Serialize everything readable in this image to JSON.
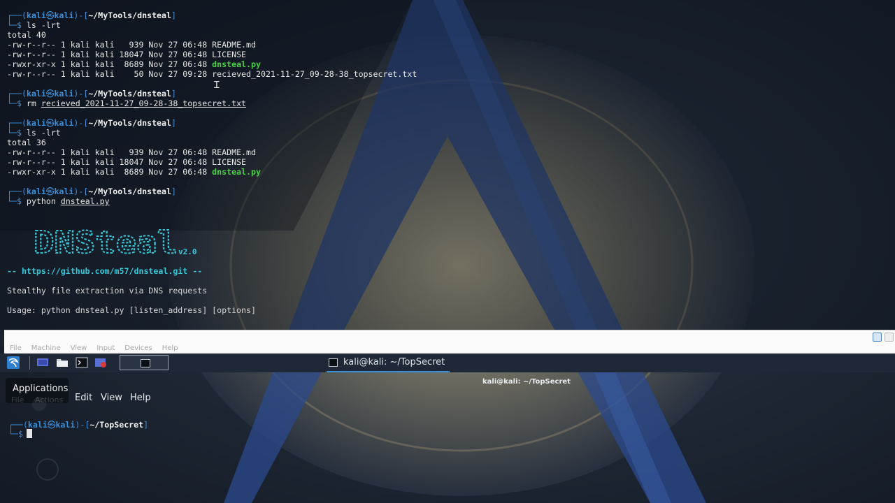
{
  "terminal_top": {
    "prompt_user": "kali",
    "prompt_at": "㉿",
    "prompt_host": "kali",
    "prompt_path": "~/MyTools/dnsteal",
    "commands": {
      "c1": "ls -lrt",
      "c2_cmd": "rm",
      "c2_arg": "recieved_2021-11-27_09-28-38_topsecret.txt",
      "c3": "ls -lrt",
      "c4_cmd": "python",
      "c4_arg": "dnsteal.py"
    },
    "listing1": {
      "total": "total 40",
      "rows": [
        {
          "meta": "-rw-r--r-- 1 kali kali   939 Nov 27 06:48 ",
          "name": "README.md"
        },
        {
          "meta": "-rw-r--r-- 1 kali kali 18047 Nov 27 06:48 ",
          "name": "LICENSE"
        },
        {
          "meta": "-rwxr-xr-x 1 kali kali  8689 Nov 27 06:48 ",
          "name": "dnsteal.py"
        },
        {
          "meta": "-rw-r--r-- 1 kali kali    50 Nov 27 09:28 ",
          "name": "recieved_2021-11-27_09-28-38_topsecret.txt"
        }
      ]
    },
    "listing2": {
      "total": "total 36",
      "rows": [
        {
          "meta": "-rw-r--r-- 1 kali kali   939 Nov 27 06:48 ",
          "name": "README.md"
        },
        {
          "meta": "-rw-r--r-- 1 kali kali 18047 Nov 27 06:48 ",
          "name": "LICENSE"
        },
        {
          "meta": "-rwxr-xr-x 1 kali kali  8689 Nov 27 06:48 ",
          "name": "dnsteal.py"
        }
      ]
    },
    "banner": {
      "logo_text": "DNSteal",
      "version": "v2.0",
      "url_line": "-- https://github.com/m57/dnsteal.git --",
      "tagline": "Stealthy file extraction via DNS requests",
      "usage": "Usage: python dnsteal.py [listen_address] [options]"
    }
  },
  "vm_menubar": {
    "items": [
      "File",
      "Machine",
      "View",
      "Input",
      "Devices",
      "Help"
    ]
  },
  "taskbar": {
    "task_label": "kali@kali: ~/TopSecret"
  },
  "window": {
    "title": "kali@kali: ~/TopSecret",
    "tooltip": "Applications",
    "menu": {
      "file": "File",
      "actions": "Actions",
      "edit": "Edit",
      "view": "View",
      "help": "Help"
    },
    "prompt_path": "~/TopSecret"
  },
  "colors": {
    "prompt_blue": "#3c8fd9",
    "exec_green": "#4fd04a",
    "banner_cyan": "#37c8d8",
    "taskbar_bg": "#1e2836",
    "accent": "#3a8fd6"
  },
  "icons": [
    "kali-menu-icon",
    "desktop-icon",
    "file-manager-icon",
    "terminal-icon",
    "recorder-icon",
    "vm-usb-icon",
    "vm-network-icon"
  ]
}
